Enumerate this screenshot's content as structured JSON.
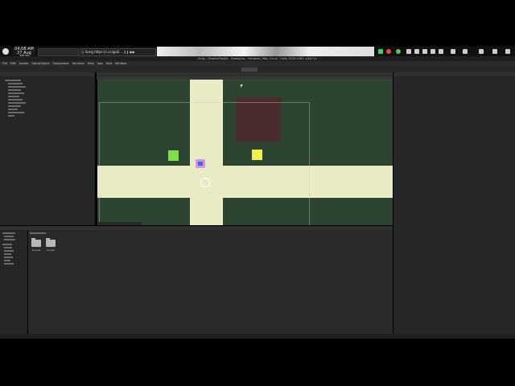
{
  "taskbar": {
    "time": "04:08 AM",
    "date": "27 Aug 2020",
    "now_playing": "♫ Song  https://i.cc/qjaE…  ❙❙ ▶▶"
  },
  "window": {
    "title": "Unity - ShooterToolkit - Gameplay - Windows, Mac, Linux - Unity 2019.4.6f1 <DX11>"
  },
  "menu": [
    "File",
    "Edit",
    "Assets",
    "GameObject",
    "Component",
    "Services",
    "Help",
    "Jobs",
    "Bolt",
    "Window"
  ],
  "panels": {
    "hierarchy": "Hierarchy",
    "scene": "Scene",
    "inspector": "Inspector",
    "project": "Project"
  },
  "project": {
    "folders": [
      {
        "name": "Scenes"
      },
      {
        "name": "Scripts"
      }
    ]
  },
  "scene": {
    "colors": {
      "grass": "#2d4430",
      "road": "#e8ebc3",
      "wall": "#4a2c2c",
      "pickup_green": "#7de04a",
      "pickup_yellow": "#f2f04a",
      "player": "#d88fe8"
    }
  }
}
